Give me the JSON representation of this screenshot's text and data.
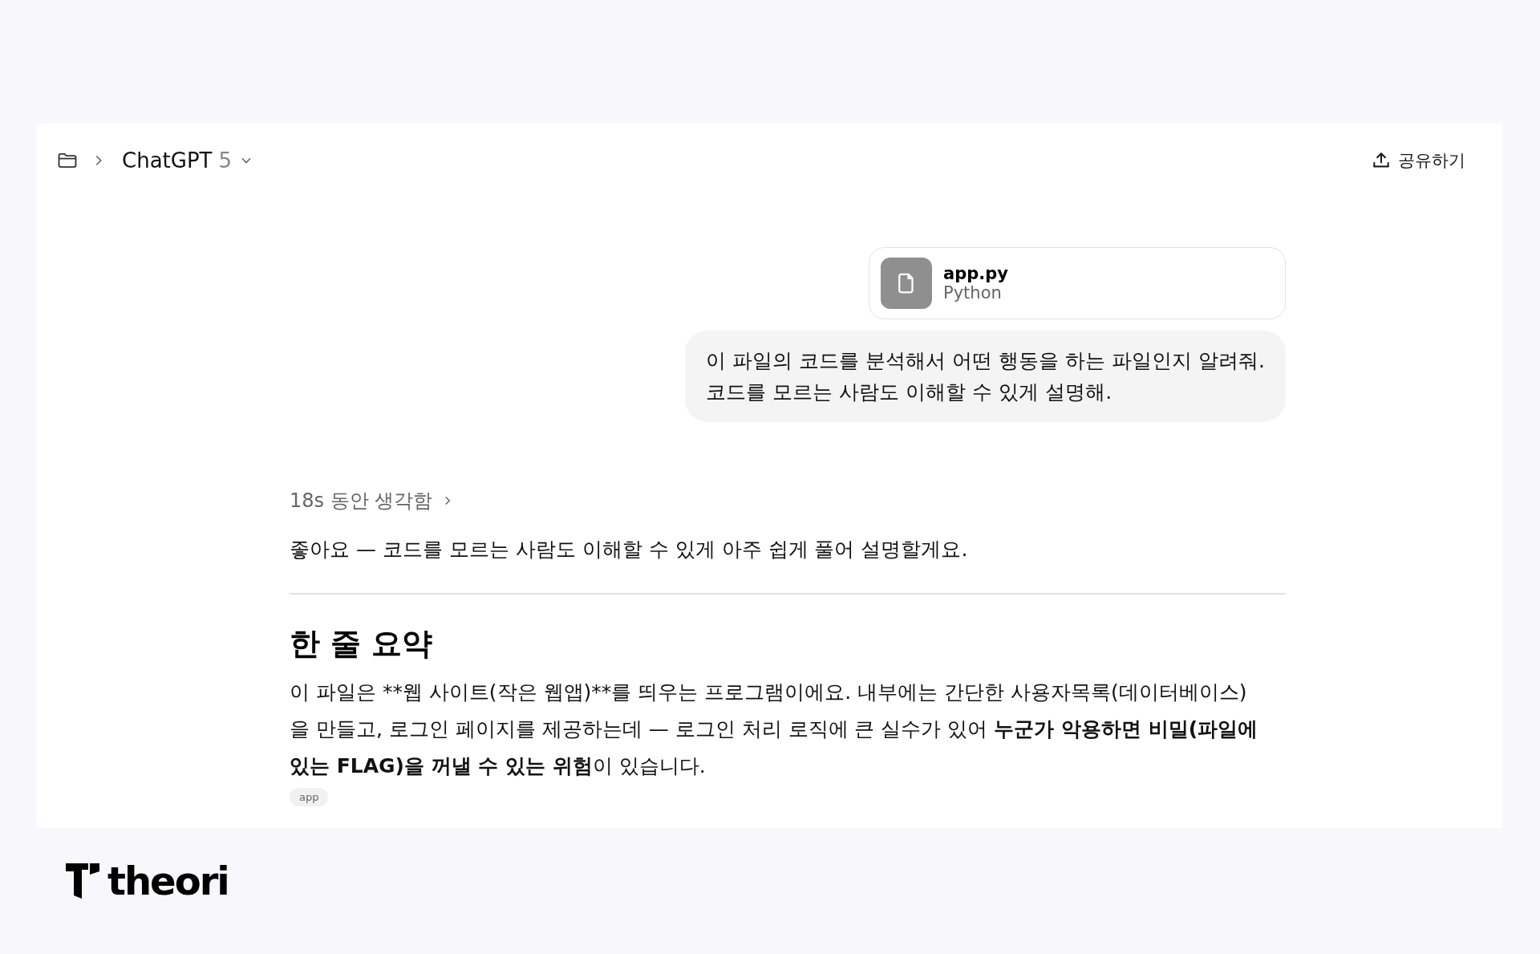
{
  "header": {
    "title": "ChatGPT",
    "model": "5",
    "share_label": "공유하기"
  },
  "attachment": {
    "name": "app.py",
    "type": "Python"
  },
  "user_message": {
    "lines": [
      "이 파일의 코드를 분석해서 어떤 행동을 하는 파일인지 알려줘.",
      "코드를 모르는 사람도 이해할 수 있게 설명해."
    ]
  },
  "thinking": {
    "label": "18s 동안 생각함"
  },
  "reply": {
    "intro": "좋아요 — 코드를 모르는 사람도 이해할 수 있게 아주 쉽게 풀어 설명할게요.",
    "heading": "한 줄 요약",
    "paragraph": [
      {
        "text": "이 파일은 **웹 사이트(작은 웹앱)**를 띄우는 프로그램이에요. 내부에는 간단한 사용자목록(데이터베이스)을 만들고, 로그인 페이지를 제공하는데 — 로그인 처리 로직에 큰 실수가 있어 ",
        "bold": false
      },
      {
        "text": "누군가 악용하면 비밀(파일에 있는 FLAG)을 꺼낼 수 있는 위험",
        "bold": true
      },
      {
        "text": "이 있습니다.",
        "bold": false
      }
    ],
    "citation": "app"
  },
  "brand": {
    "name": "theori"
  }
}
